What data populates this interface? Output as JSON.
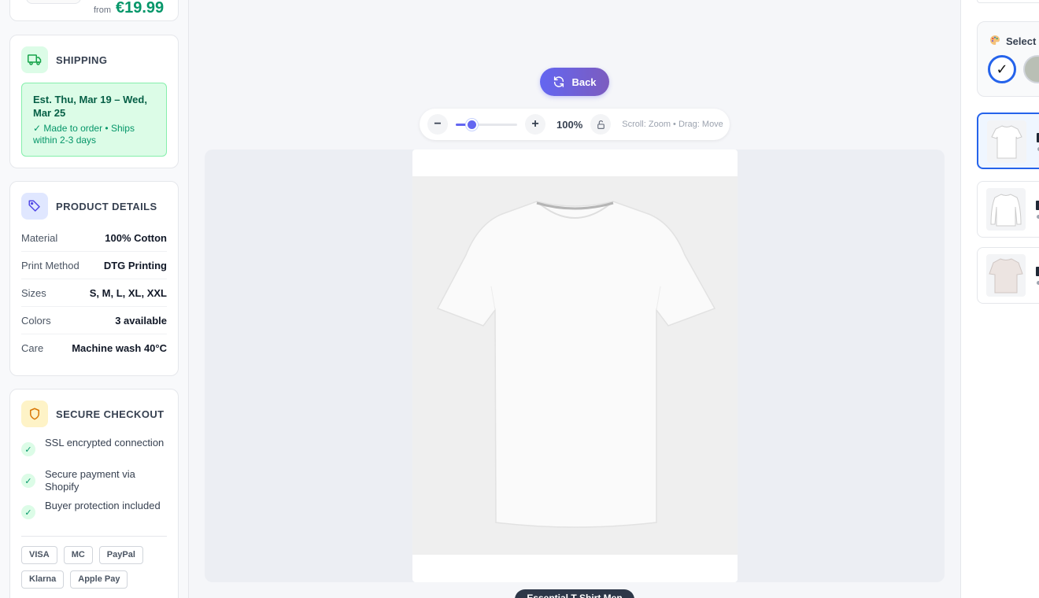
{
  "summary": {
    "from_label": "from",
    "price": "€19.99"
  },
  "shipping": {
    "title": "SHIPPING",
    "estimate": "Est. Thu, Mar 19 – Wed, Mar 25",
    "note": "✓ Made to order • Ships within 2-3 days"
  },
  "details": {
    "title": "PRODUCT DETAILS",
    "rows": [
      {
        "label": "Material",
        "value": "100% Cotton"
      },
      {
        "label": "Print Method",
        "value": "DTG Printing"
      },
      {
        "label": "Sizes",
        "value": "S, M, L, XL, XXL"
      },
      {
        "label": "Colors",
        "value": "3 available"
      },
      {
        "label": "Care",
        "value": "Machine wash 40°C"
      }
    ]
  },
  "checkout": {
    "title": "SECURE CHECKOUT",
    "items": [
      "SSL encrypted connection",
      "Secure payment via Shopify",
      "Buyer protection included"
    ],
    "payments": [
      "VISA",
      "MC",
      "PayPal",
      "Klarna",
      "Apple Pay"
    ]
  },
  "toolbar": {
    "back_label": "Back",
    "zoom_value": "100%",
    "zoom_level": 0.2,
    "hint": "Scroll: Zoom • Drag: Move"
  },
  "preview": {
    "product_name": "Essential T-Shirt Men"
  },
  "colors": {
    "title": "Select",
    "swatches": [
      {
        "name": "white",
        "hex": "#ffffff",
        "selected": true
      },
      {
        "name": "sage",
        "hex": "#b9bfb5",
        "selected": false
      }
    ]
  },
  "icons": {
    "shipping": "truck-icon",
    "details": "tag-icon",
    "checkout": "shield-icon",
    "back": "refresh-icon",
    "lock": "lock-icon",
    "palette": "palette-icon"
  },
  "accent_colors": {
    "primary": "#6366f1",
    "success": "#059669",
    "selected": "#2563eb"
  }
}
